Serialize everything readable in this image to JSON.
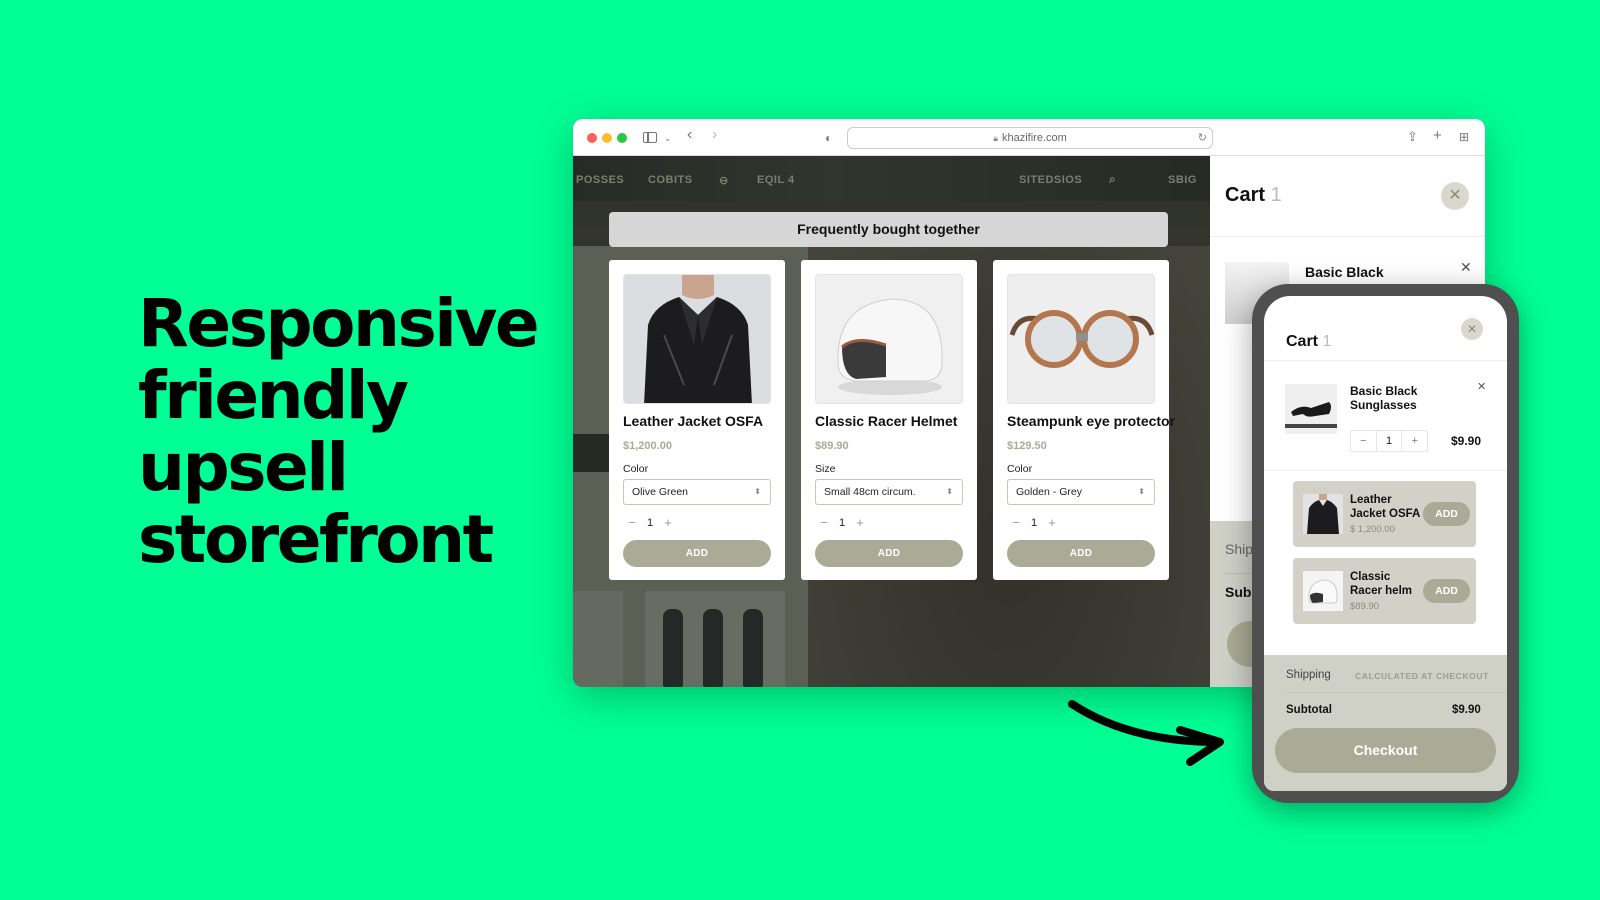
{
  "headline": {
    "lines": [
      "Responsive",
      "friendly",
      "upsell",
      "storefront"
    ]
  },
  "browser": {
    "url": "khazifire.com",
    "icons": {
      "sidebar": "sidebar-icon",
      "back": "chevron-left-icon",
      "forward": "chevron-right-icon",
      "privacy": "shield-icon",
      "lock": "lock-icon",
      "reload": "reload-icon",
      "share": "share-icon",
      "new_tab": "plus-icon",
      "tabs": "tab-grid-icon"
    }
  },
  "store": {
    "nav_items": [
      "POSSES",
      "COBITS",
      "EQIL 4",
      "SITEDSIOS",
      "SBIG"
    ],
    "modal": {
      "title": "Frequently bought together",
      "products": [
        {
          "name": "Leather Jacket OSFA",
          "price": "$1,200.00",
          "option_label": "Color",
          "option_value": "Olive Green",
          "quantity": "1",
          "add_label": "ADD",
          "image": "leather-jacket"
        },
        {
          "name": "Classic Racer Helmet",
          "price": "$89.90",
          "option_label": "Size",
          "option_value": "Small 48cm circum.",
          "quantity": "1",
          "add_label": "ADD",
          "image": "white-helmet"
        },
        {
          "name": "Steampunk eye protector",
          "price": "$129.50",
          "option_label": "Color",
          "option_value": "Golden - Grey",
          "quantity": "1",
          "add_label": "ADD",
          "image": "steampunk-goggles"
        }
      ]
    }
  },
  "desktop_cart": {
    "title": "Cart",
    "count": "1",
    "item_name": "Basic Black",
    "shipping_label": "Ship",
    "subtotal_label": "Sub"
  },
  "mobile_cart": {
    "title": "Cart",
    "count": "1",
    "item": {
      "name": "Basic Black Sunglasses",
      "quantity": "1",
      "price": "$9.90"
    },
    "upsells": [
      {
        "name": "Leather Jacket OSFA",
        "price": "$ 1,200.00",
        "add_label": "ADD"
      },
      {
        "name": "Classic Racer helm",
        "price": "$89.90",
        "add_label": "ADD"
      }
    ],
    "shipping_label": "Shipping",
    "shipping_value": "CALCULATED AT CHECKOUT",
    "subtotal_label": "Subtotal",
    "subtotal_value": "$9.90",
    "checkout_label": "Checkout"
  },
  "colors": {
    "background": "#00ff94",
    "accent_button": "#a9ab97",
    "price_text": "#a8ab95",
    "cart_footer": "#cfd0c6"
  }
}
